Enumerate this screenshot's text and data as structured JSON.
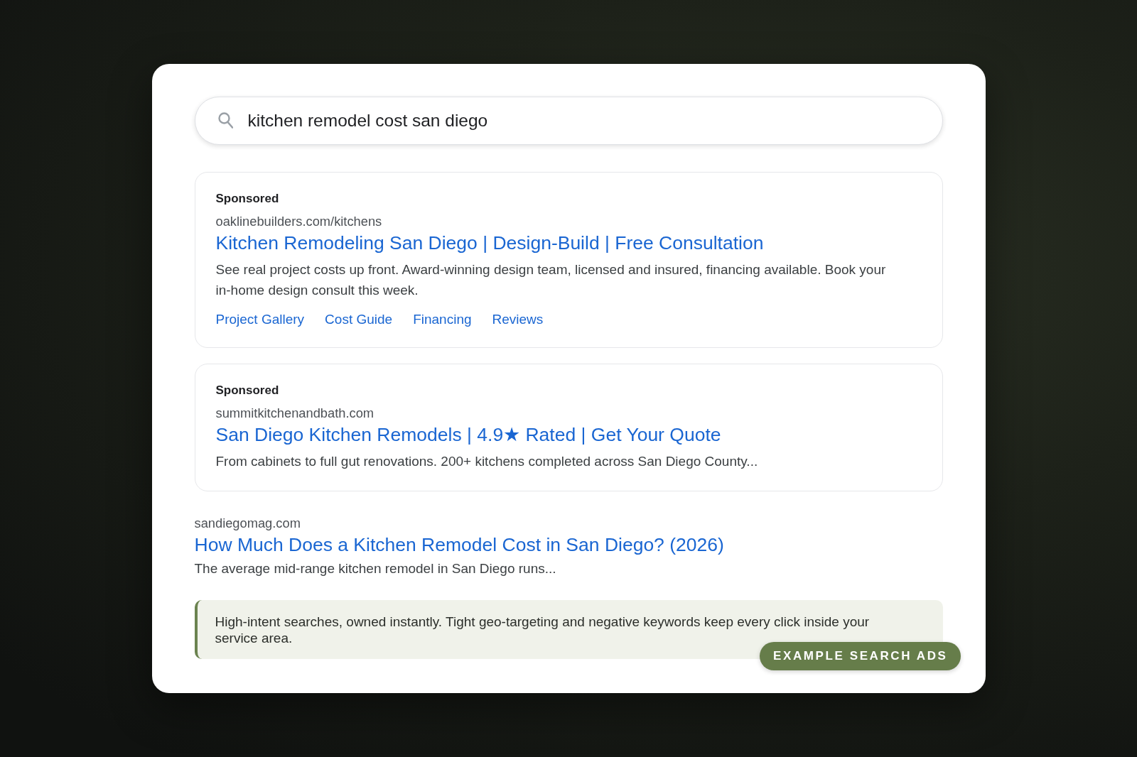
{
  "search": {
    "query": "kitchen remodel cost san diego"
  },
  "results": [
    {
      "kind": "ad",
      "label": "Sponsored",
      "url": "oaklinebuilders.com/kitchens",
      "title": "Kitchen Remodeling San Diego | Design-Build | Free Consultation",
      "description": "See real project costs up front. Award-winning design team, licensed and insured, financing available. Book your in-home design consult this week.",
      "sitelinks": [
        "Project Gallery",
        "Cost Guide",
        "Financing",
        "Reviews"
      ]
    },
    {
      "kind": "ad",
      "label": "Sponsored",
      "url": "summitkitchenandbath.com",
      "title": "San Diego Kitchen Remodels | 4.9★ Rated | Get Your Quote",
      "description": "From cabinets to full gut renovations. 200+ kitchens completed across San Diego County..."
    },
    {
      "kind": "organic",
      "url": "sandiegomag.com",
      "title": "How Much Does a Kitchen Remodel Cost in San Diego? (2026)",
      "description": "The average mid-range kitchen remodel in San Diego runs..."
    }
  ],
  "callout": {
    "text": "High-intent searches, owned instantly. Tight geo-targeting and negative keywords keep every click inside your service area.",
    "badge": "EXAMPLE SEARCH ADS"
  }
}
